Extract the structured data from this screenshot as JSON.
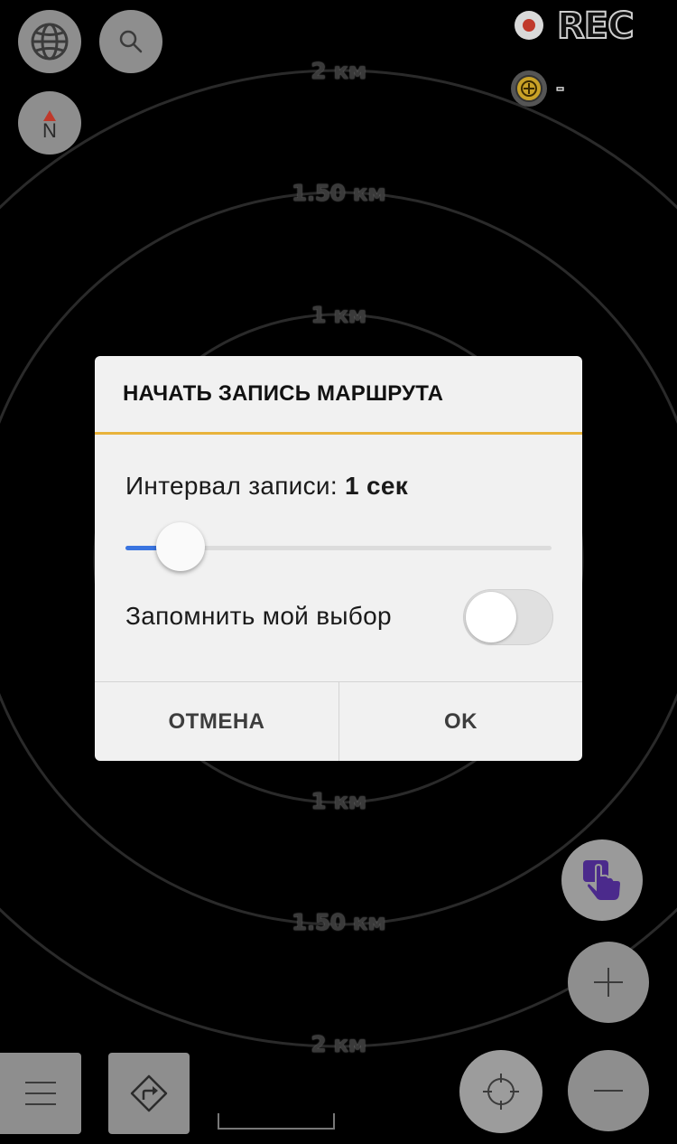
{
  "map": {
    "ring_labels": [
      "2 км",
      "1.50 км",
      "1 км",
      "1 км",
      "1.50 км",
      "2 км"
    ]
  },
  "top_left": {
    "globe_icon": "globe-icon",
    "search_icon": "search-icon",
    "compass_icon": "compass-north-icon",
    "compass_label": "N"
  },
  "top_right": {
    "rec_label": "REC",
    "gps_status": "-"
  },
  "dialog": {
    "title": "НАЧАТЬ ЗАПИСЬ МАРШРУТА",
    "interval_label": "Интервал записи:",
    "interval_value": "1 сек",
    "slider_value_fraction": 0.13,
    "remember_label": "Запомнить мой выбор",
    "remember_checked": false,
    "cancel_label": "ОТМЕНА",
    "ok_label": "OK"
  },
  "colors": {
    "accent_rule": "#e8b33c",
    "slider_fill": "#3a74e0",
    "button_gray": "#8e8e8e",
    "touch_mode_purple": "#4b2a8c",
    "rec_dot": "#c0392b",
    "gps_ring": "#c9a227"
  }
}
